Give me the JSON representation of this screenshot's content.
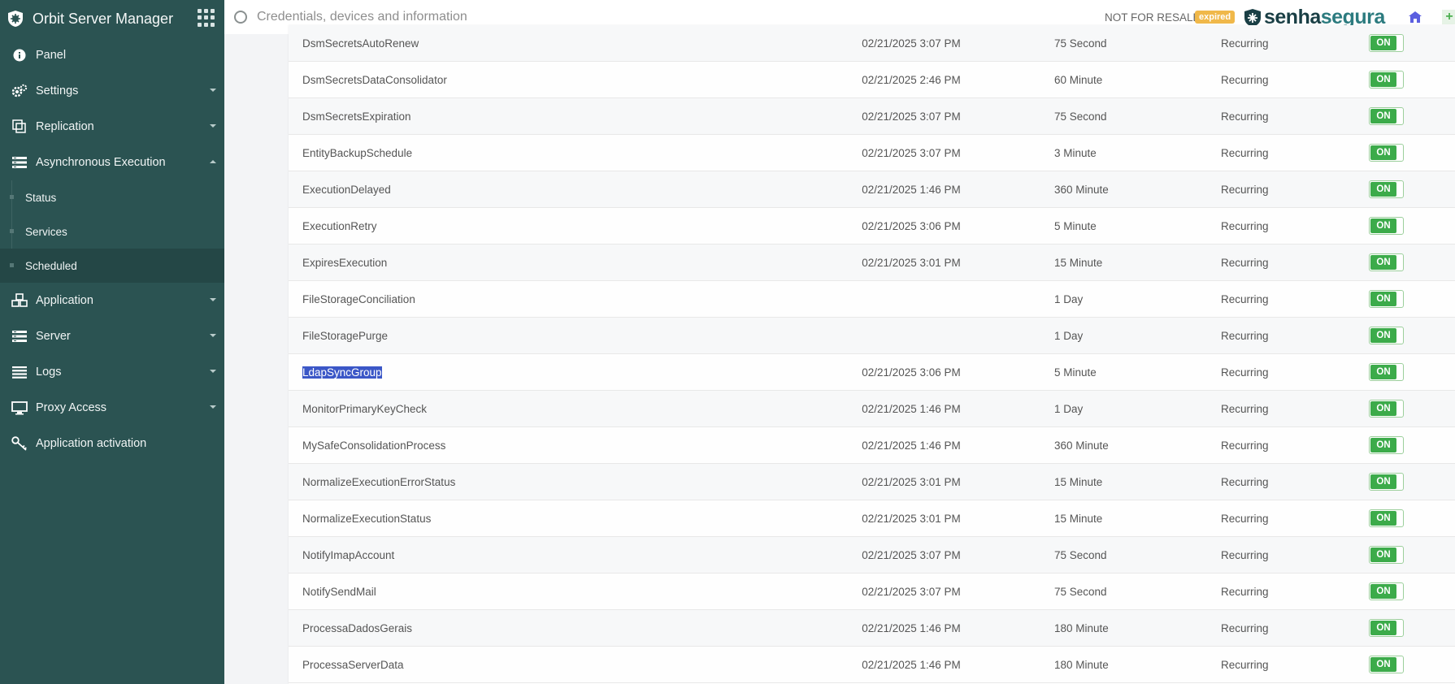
{
  "app": {
    "title": "Orbit Server Manager"
  },
  "sidebar": {
    "items": [
      {
        "label": "Panel"
      },
      {
        "label": "Settings"
      },
      {
        "label": "Replication"
      },
      {
        "label": "Asynchronous Execution"
      },
      {
        "label": "Application"
      },
      {
        "label": "Server"
      },
      {
        "label": "Logs"
      },
      {
        "label": "Proxy Access"
      },
      {
        "label": "Application activation"
      }
    ],
    "async_sub": [
      {
        "label": "Status"
      },
      {
        "label": "Services"
      },
      {
        "label": "Scheduled"
      }
    ]
  },
  "topbar": {
    "search_placeholder": "Credentials, devices and information",
    "license_text": "NOT FOR RESALE",
    "license_badge": "expired",
    "brand_part1": "senha",
    "brand_part2": "segura"
  },
  "table": {
    "rows": [
      {
        "name": "DsmSecretsAutoRenew",
        "date": "02/21/2025 3:07 PM",
        "interval": "75 Second",
        "type": "Recurring",
        "status": "ON"
      },
      {
        "name": "DsmSecretsDataConsolidator",
        "date": "02/21/2025 2:46 PM",
        "interval": "60 Minute",
        "type": "Recurring",
        "status": "ON"
      },
      {
        "name": "DsmSecretsExpiration",
        "date": "02/21/2025 3:07 PM",
        "interval": "75 Second",
        "type": "Recurring",
        "status": "ON"
      },
      {
        "name": "EntityBackupSchedule",
        "date": "02/21/2025 3:07 PM",
        "interval": "3 Minute",
        "type": "Recurring",
        "status": "ON"
      },
      {
        "name": "ExecutionDelayed",
        "date": "02/21/2025 1:46 PM",
        "interval": "360 Minute",
        "type": "Recurring",
        "status": "ON"
      },
      {
        "name": "ExecutionRetry",
        "date": "02/21/2025 3:06 PM",
        "interval": "5 Minute",
        "type": "Recurring",
        "status": "ON"
      },
      {
        "name": "ExpiresExecution",
        "date": "02/21/2025 3:01 PM",
        "interval": "15 Minute",
        "type": "Recurring",
        "status": "ON"
      },
      {
        "name": "FileStorageConciliation",
        "date": "",
        "interval": "1 Day",
        "type": "Recurring",
        "status": "ON"
      },
      {
        "name": "FileStoragePurge",
        "date": "",
        "interval": "1 Day",
        "type": "Recurring",
        "status": "ON"
      },
      {
        "name": "LdapSyncGroup",
        "date": "02/21/2025 3:06 PM",
        "interval": "5 Minute",
        "type": "Recurring",
        "status": "ON"
      },
      {
        "name": "MonitorPrimaryKeyCheck",
        "date": "02/21/2025 1:46 PM",
        "interval": "1 Day",
        "type": "Recurring",
        "status": "ON"
      },
      {
        "name": "MySafeConsolidationProcess",
        "date": "02/21/2025 1:46 PM",
        "interval": "360 Minute",
        "type": "Recurring",
        "status": "ON"
      },
      {
        "name": "NormalizeExecutionErrorStatus",
        "date": "02/21/2025 3:01 PM",
        "interval": "15 Minute",
        "type": "Recurring",
        "status": "ON"
      },
      {
        "name": "NormalizeExecutionStatus",
        "date": "02/21/2025 3:01 PM",
        "interval": "15 Minute",
        "type": "Recurring",
        "status": "ON"
      },
      {
        "name": "NotifyImapAccount",
        "date": "02/21/2025 3:07 PM",
        "interval": "75 Second",
        "type": "Recurring",
        "status": "ON"
      },
      {
        "name": "NotifySendMail",
        "date": "02/21/2025 3:07 PM",
        "interval": "75 Second",
        "type": "Recurring",
        "status": "ON"
      },
      {
        "name": "ProcessaDadosGerais",
        "date": "02/21/2025 1:46 PM",
        "interval": "180 Minute",
        "type": "Recurring",
        "status": "ON"
      },
      {
        "name": "ProcessaServerData",
        "date": "02/21/2025 1:46 PM",
        "interval": "180 Minute",
        "type": "Recurring",
        "status": "ON"
      }
    ]
  }
}
